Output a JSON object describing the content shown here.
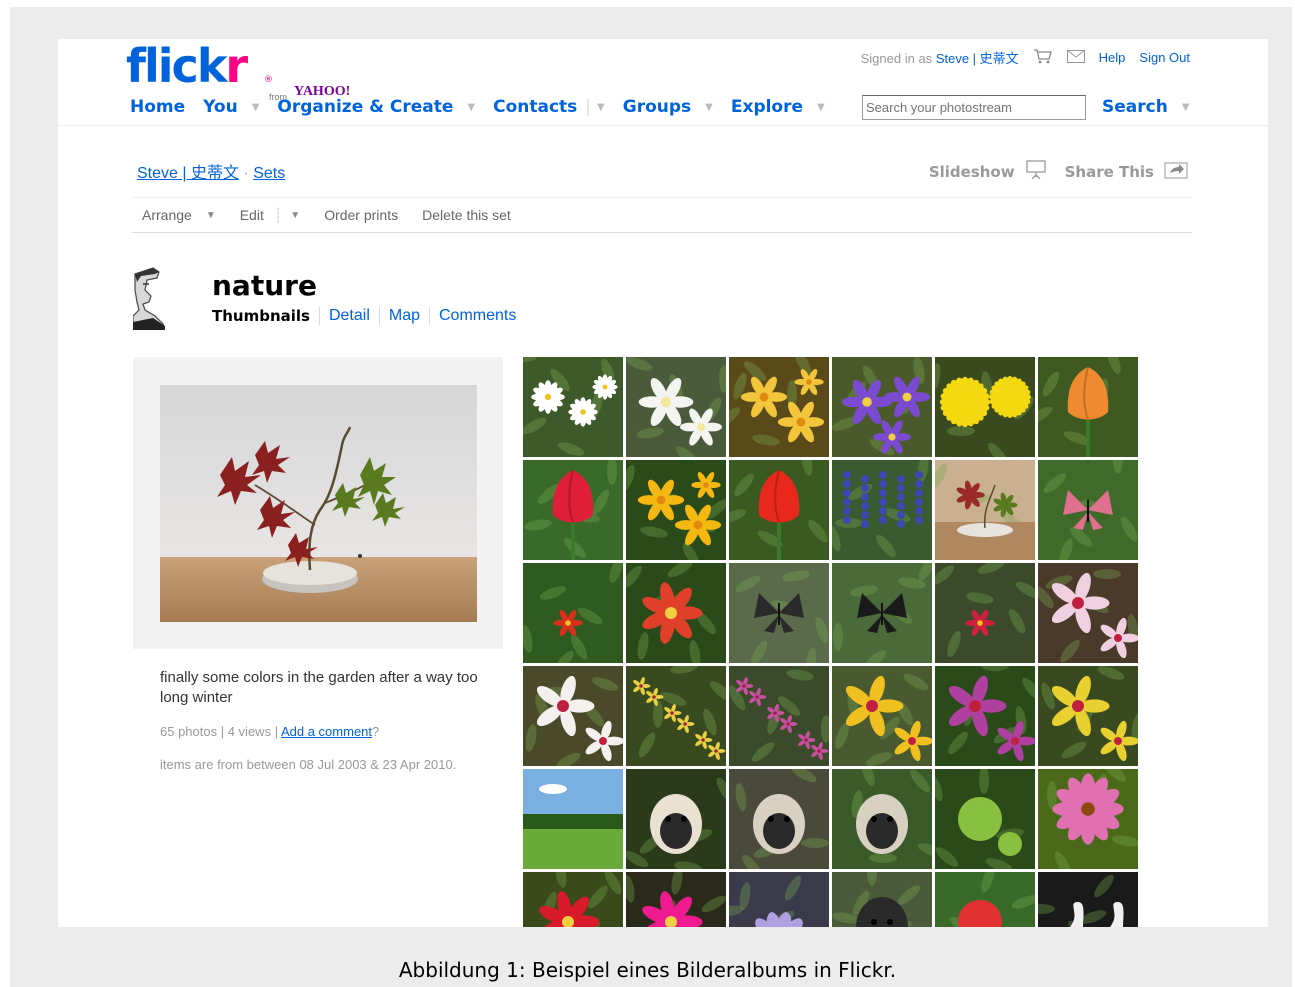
{
  "header": {
    "logo_text": "flickr",
    "logo_from": "from",
    "logo_yahoo": "YAHOO!",
    "signed_in_prefix": "Signed in as",
    "user_name": "Steve | 史蒂文",
    "help": "Help",
    "sign_out": "Sign Out",
    "cart_icon": "cart-icon",
    "mail_icon": "mail-icon"
  },
  "nav": {
    "home": "Home",
    "you": "You",
    "organize": "Organize & Create",
    "contacts": "Contacts",
    "groups": "Groups",
    "explore": "Explore",
    "search_placeholder": "Search your photostream",
    "search_button": "Search"
  },
  "breadcrumb": {
    "user": "Steve | 史蒂文",
    "separator": "·",
    "sets": "Sets"
  },
  "actions": {
    "slideshow": "Slideshow",
    "share": "Share This"
  },
  "toolbar": {
    "arrange": "Arrange",
    "edit": "Edit",
    "order_prints": "Order prints",
    "delete_set": "Delete this set"
  },
  "set": {
    "title": "nature",
    "view_thumbnails": "Thumbnails",
    "view_detail": "Detail",
    "view_map": "Map",
    "view_comments": "Comments",
    "description": "finally some colors in the garden after a way too long winter",
    "photos_count": "65 photos",
    "views_count": "4 views",
    "add_comment": "Add a comment",
    "date_range": "items are from between 08 Jul 2003 & 23 Apr 2010."
  },
  "thumbnails": [
    {
      "bg": "#3f5a2a",
      "fg": "#ffffff",
      "kind": "daisy"
    },
    {
      "bg": "#4a5a3a",
      "fg": "#f4f4f0",
      "kind": "white"
    },
    {
      "bg": "#5a4a1a",
      "fg": "#f2c53a",
      "kind": "yellow"
    },
    {
      "bg": "#4a5a2a",
      "fg": "#7a4ad0",
      "kind": "crocus"
    },
    {
      "bg": "#3a4a1e",
      "fg": "#f5d910",
      "kind": "dandelion"
    },
    {
      "bg": "#3f5a20",
      "fg": "#f08a30",
      "kind": "tulip"
    },
    {
      "bg": "#3a6a2a",
      "fg": "#e0203a",
      "kind": "tulip"
    },
    {
      "bg": "#2a4a1a",
      "fg": "#f5b810",
      "kind": "yellow"
    },
    {
      "bg": "#3a5a22",
      "fg": "#e8281a",
      "kind": "tulip"
    },
    {
      "bg": "#3a5a30",
      "fg": "#3a4ab0",
      "kind": "hyacinth"
    },
    {
      "bg": "#c8b090",
      "fg": "#9a2a2a",
      "kind": "bonsai"
    },
    {
      "bg": "#3f6a2a",
      "fg": "#e07090",
      "kind": "butterfly"
    },
    {
      "bg": "#2f5a20",
      "fg": "#d8301a",
      "kind": "leaves"
    },
    {
      "bg": "#2a4a1a",
      "fg": "#e0402a",
      "kind": "red"
    },
    {
      "bg": "#5a6a4a",
      "fg": "#2a2a2a",
      "kind": "butterfly"
    },
    {
      "bg": "#4a6a3a",
      "fg": "#1a1a1a",
      "kind": "butterfly"
    },
    {
      "bg": "#3a4a2a",
      "fg": "#d02040",
      "kind": "leaves"
    },
    {
      "bg": "#4a3a2a",
      "fg": "#f0d0e0",
      "kind": "orchid"
    },
    {
      "bg": "#4a4a2a",
      "fg": "#f4f0ee",
      "kind": "orchid"
    },
    {
      "bg": "#3a4a20",
      "fg": "#e8d040",
      "kind": "small"
    },
    {
      "bg": "#3a4a2a",
      "fg": "#c850a0",
      "kind": "small"
    },
    {
      "bg": "#4a5a30",
      "fg": "#f0c020",
      "kind": "orchid"
    },
    {
      "bg": "#2a4a1a",
      "fg": "#b040a0",
      "kind": "orchid"
    },
    {
      "bg": "#3a4a20",
      "fg": "#e8d030",
      "kind": "orchid"
    },
    {
      "bg": "#5a9a3a",
      "fg": "#7ab0e0",
      "kind": "landscape"
    },
    {
      "bg": "#2a3a1a",
      "fg": "#e8e0d0",
      "kind": "goat"
    },
    {
      "bg": "#4a4a3a",
      "fg": "#d8d0c0",
      "kind": "goat"
    },
    {
      "bg": "#3a5a2a",
      "fg": "#d8d0c0",
      "kind": "goat"
    },
    {
      "bg": "#2a4a1a",
      "fg": "#8ac040",
      "kind": "fruit"
    },
    {
      "bg": "#4a6a1a",
      "fg": "#e070b0",
      "kind": "coneflower"
    },
    {
      "bg": "#3a4a1a",
      "fg": "#d81a2a",
      "kind": "red"
    },
    {
      "bg": "#2a2a1a",
      "fg": "#f01a90",
      "kind": "red"
    },
    {
      "bg": "#3a3a4a",
      "fg": "#b0a0e0",
      "kind": "star"
    },
    {
      "bg": "#4a5a3a",
      "fg": "#2a2a2a",
      "kind": "goat"
    },
    {
      "bg": "#3a6a2a",
      "fg": "#e03030",
      "kind": "fruit"
    },
    {
      "bg": "#1a1a1a",
      "fg": "#f0f0f0",
      "kind": "goose"
    }
  ],
  "caption": "Abbildung 1: Beispiel eines Bilderalbums in Flickr."
}
